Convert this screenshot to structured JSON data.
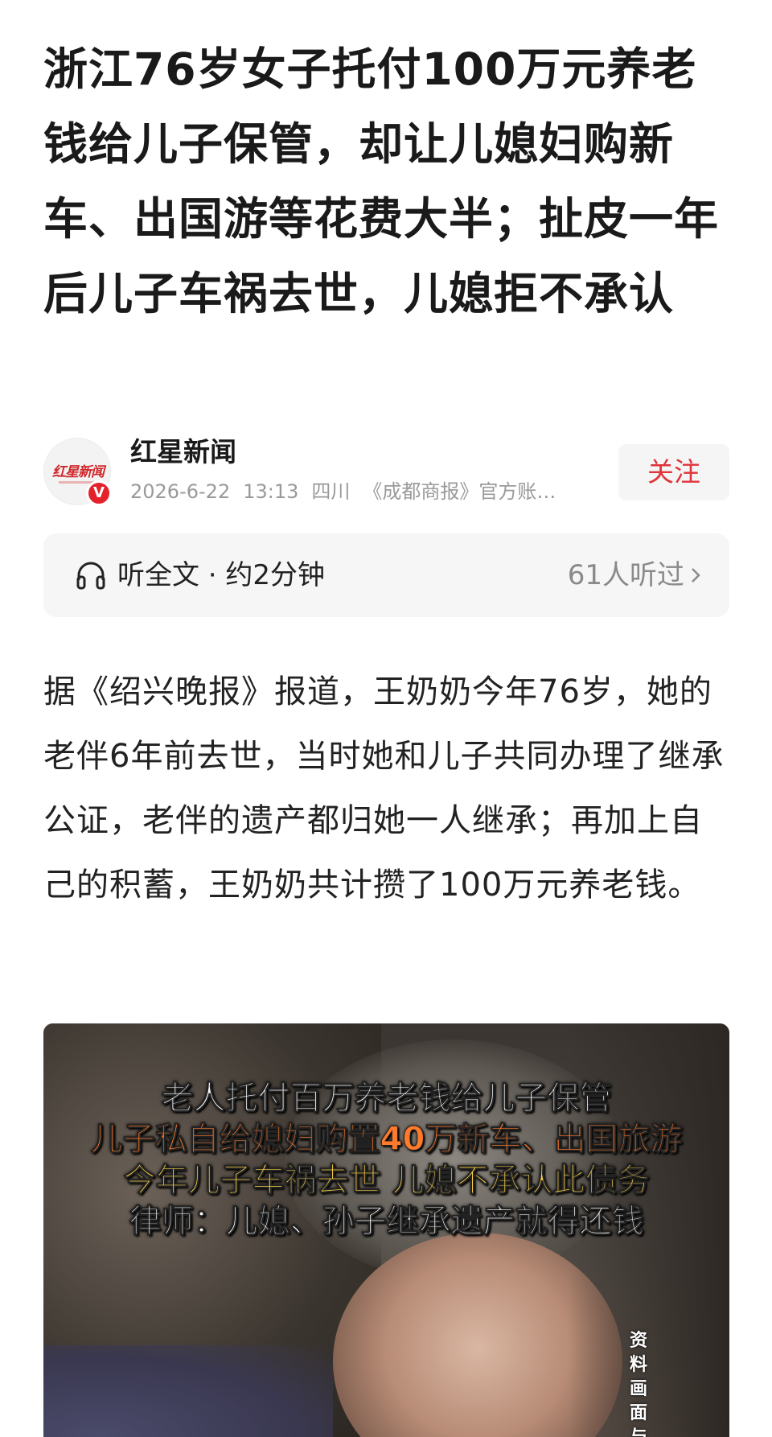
{
  "article": {
    "title": "浙江76岁女子托付100万元养老钱给儿子保管，却让儿媳妇购新车、出国游等花费大半；扯皮一年后儿子车祸去世，儿媳拒不承认",
    "body": "据《绍兴晚报》报道，王奶奶今年76岁，她的老伴6年前去世，当时她和儿子共同办理了继承公证，老伴的遗产都归她一人继承；再加上自己的积蓄，王奶奶共计攒了100万元养老钱。"
  },
  "author": {
    "logo_text": "红星新闻",
    "verified_badge": "V",
    "name": "红星新闻",
    "date": "2026-6-22",
    "time": "13:13",
    "location": "四川",
    "description": "《成都商报》官方账…",
    "follow_label": "关注"
  },
  "listen": {
    "icon": "headphones-icon",
    "label": "听全文 · 约2分钟",
    "count": "61人听过"
  },
  "video": {
    "captions": [
      "老人托付百万养老钱给儿子保管",
      "儿子私自给媳妇购置40万新车、出国旅游",
      "今年儿子车祸去世 儿媳不承认此债务",
      "律师：儿媳、孙子继承遗产就得还钱"
    ],
    "side_note": "资料画面 与"
  },
  "colors": {
    "accent_red": "#e0343a",
    "meta_gray": "#9a9a9a",
    "caption_orange": "#ff7a2a",
    "caption_yellow": "#ffd447"
  }
}
